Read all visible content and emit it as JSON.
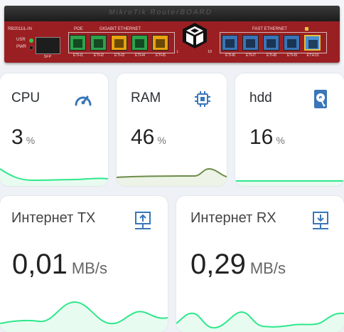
{
  "router": {
    "model": "RB2011iL-IN",
    "led_labels": [
      "USR",
      "PWR"
    ],
    "sfp_label": "SFP",
    "poe_label": "POE",
    "gigabit_label": "GIGABIT ETHERNET",
    "fast_label": "FAST ETHERNET",
    "ports": [
      "ETH1",
      "ETH2",
      "ETH3",
      "ETH4",
      "ETH5",
      "ETH6",
      "ETH7",
      "ETH8",
      "ETH9",
      "ETH10"
    ],
    "badge_left": "L",
    "badge_right": "10",
    "colors": {
      "body": "#9a1f22",
      "gigabit_a": "#2ea34a",
      "gigabit_b": "#e9a20c",
      "fast": "#3b74b8"
    }
  },
  "cards": {
    "cpu": {
      "title": "CPU",
      "value": "3",
      "unit": "%",
      "icon": "speedometer-icon",
      "color": "#2aa3ff"
    },
    "ram": {
      "title": "RAM",
      "value": "46",
      "unit": "%",
      "icon": "chip-icon",
      "color": "#6b8c4a"
    },
    "hdd": {
      "title": "hdd",
      "value": "16",
      "unit": "%",
      "icon": "harddisk-icon",
      "color": "#2ee88a"
    },
    "tx": {
      "title": "Интернет TX",
      "value": "0,01",
      "unit": "MB/s",
      "icon": "upload-network-icon",
      "color": "#2ee88a"
    },
    "rx": {
      "title": "Интернет RX",
      "value": "0,29",
      "unit": "MB/s",
      "icon": "download-network-icon",
      "color": "#2ee88a"
    }
  },
  "accent_icon_color": "#3a76b8"
}
